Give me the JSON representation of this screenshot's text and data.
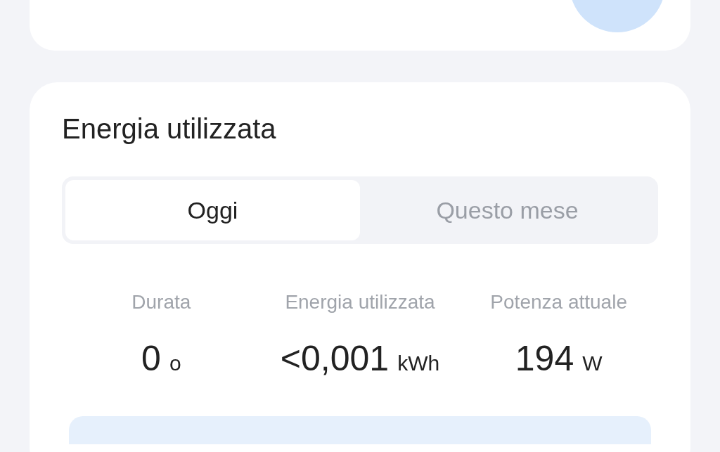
{
  "card_title": "Energia utilizzata",
  "tabs": [
    {
      "label": "Oggi",
      "selected": true
    },
    {
      "label": "Questo mese",
      "selected": false
    }
  ],
  "stats": [
    {
      "label": "Durata",
      "value": "0",
      "unit": "o"
    },
    {
      "label": "Energia utilizzata",
      "value": "<0,001",
      "unit": "kWh"
    },
    {
      "label": "Potenza attuale",
      "value": "194",
      "unit": "W"
    }
  ]
}
